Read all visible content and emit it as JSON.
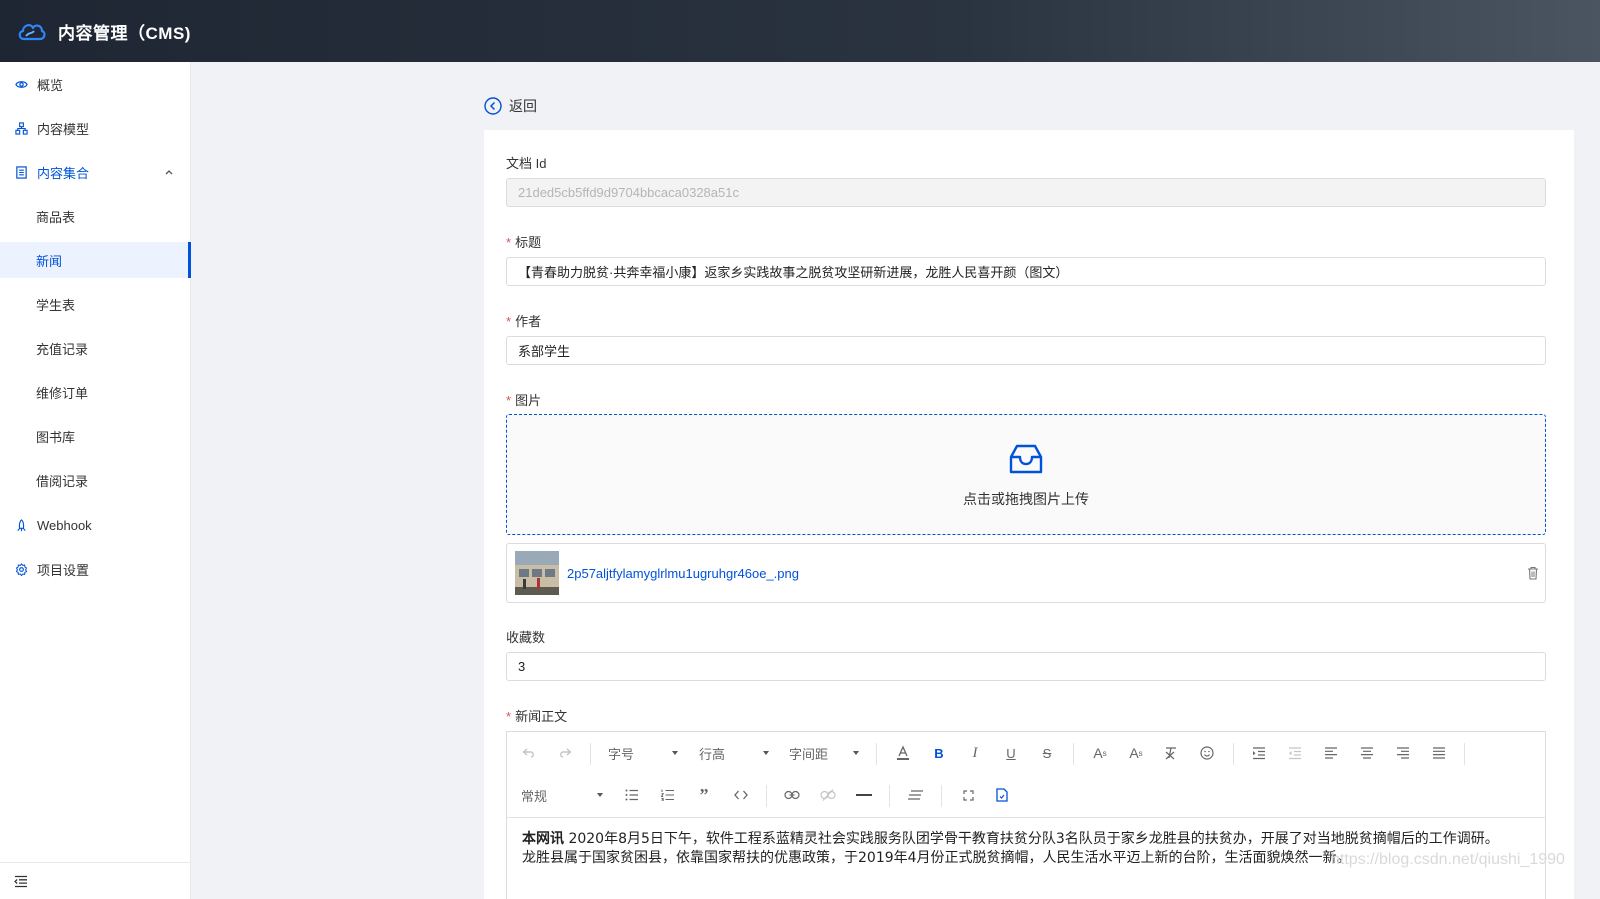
{
  "header": {
    "app_title": "内容管理（CMS)"
  },
  "sidebar": {
    "items": [
      {
        "label": "概览"
      },
      {
        "label": "内容模型"
      },
      {
        "label": "内容集合"
      },
      {
        "label": "Webhook"
      },
      {
        "label": "项目设置"
      }
    ],
    "sub_items": [
      {
        "label": "商品表"
      },
      {
        "label": "新闻"
      },
      {
        "label": "学生表"
      },
      {
        "label": "充值记录"
      },
      {
        "label": "维修订单"
      },
      {
        "label": "图书库"
      },
      {
        "label": "借阅记录"
      }
    ]
  },
  "back_label": "返回",
  "form": {
    "doc_id": {
      "label": "文档 Id",
      "value": "21ded5cb5ffd9d9704bbcaca0328a51c"
    },
    "title": {
      "label": "标题",
      "value": "【青春助力脱贫·共奔幸福小康】返家乡实践故事之脱贫攻坚研新进展，龙胜人民喜开颜（图文）"
    },
    "author": {
      "label": "作者",
      "value": "系部学生"
    },
    "image": {
      "label": "图片",
      "upload_hint": "点击或拖拽图片上传",
      "file_name": "2p57aljtfylamyglrlmu1ugruhgr46oe_.png"
    },
    "favorites": {
      "label": "收藏数",
      "value": "3"
    },
    "body": {
      "label": "新闻正文",
      "toolbar": {
        "font_size": "字号",
        "line_height": "行高",
        "letter_spacing": "字间距",
        "paragraph": "常规"
      },
      "lead": "本网讯",
      "paragraph1": "  2020年8月5日下午，软件工程系蓝精灵社会实践服务队团学骨干教育扶贫分队3名队员于家乡龙胜县的扶贫办，开展了对当地脱贫摘帽后的工作调研。",
      "paragraph2": "龙胜县属于国家贫困县，依靠国家帮扶的优惠政策，于2019年4月份正式脱贫摘帽，人民生活水平迈上新的台阶，生活面貌焕然一新。"
    }
  },
  "watermark": "https://blog.csdn.net/qiushi_1990",
  "colors": {
    "accent": "#0052d9",
    "required": "#e34d59",
    "header_dark": "#1f2633"
  }
}
